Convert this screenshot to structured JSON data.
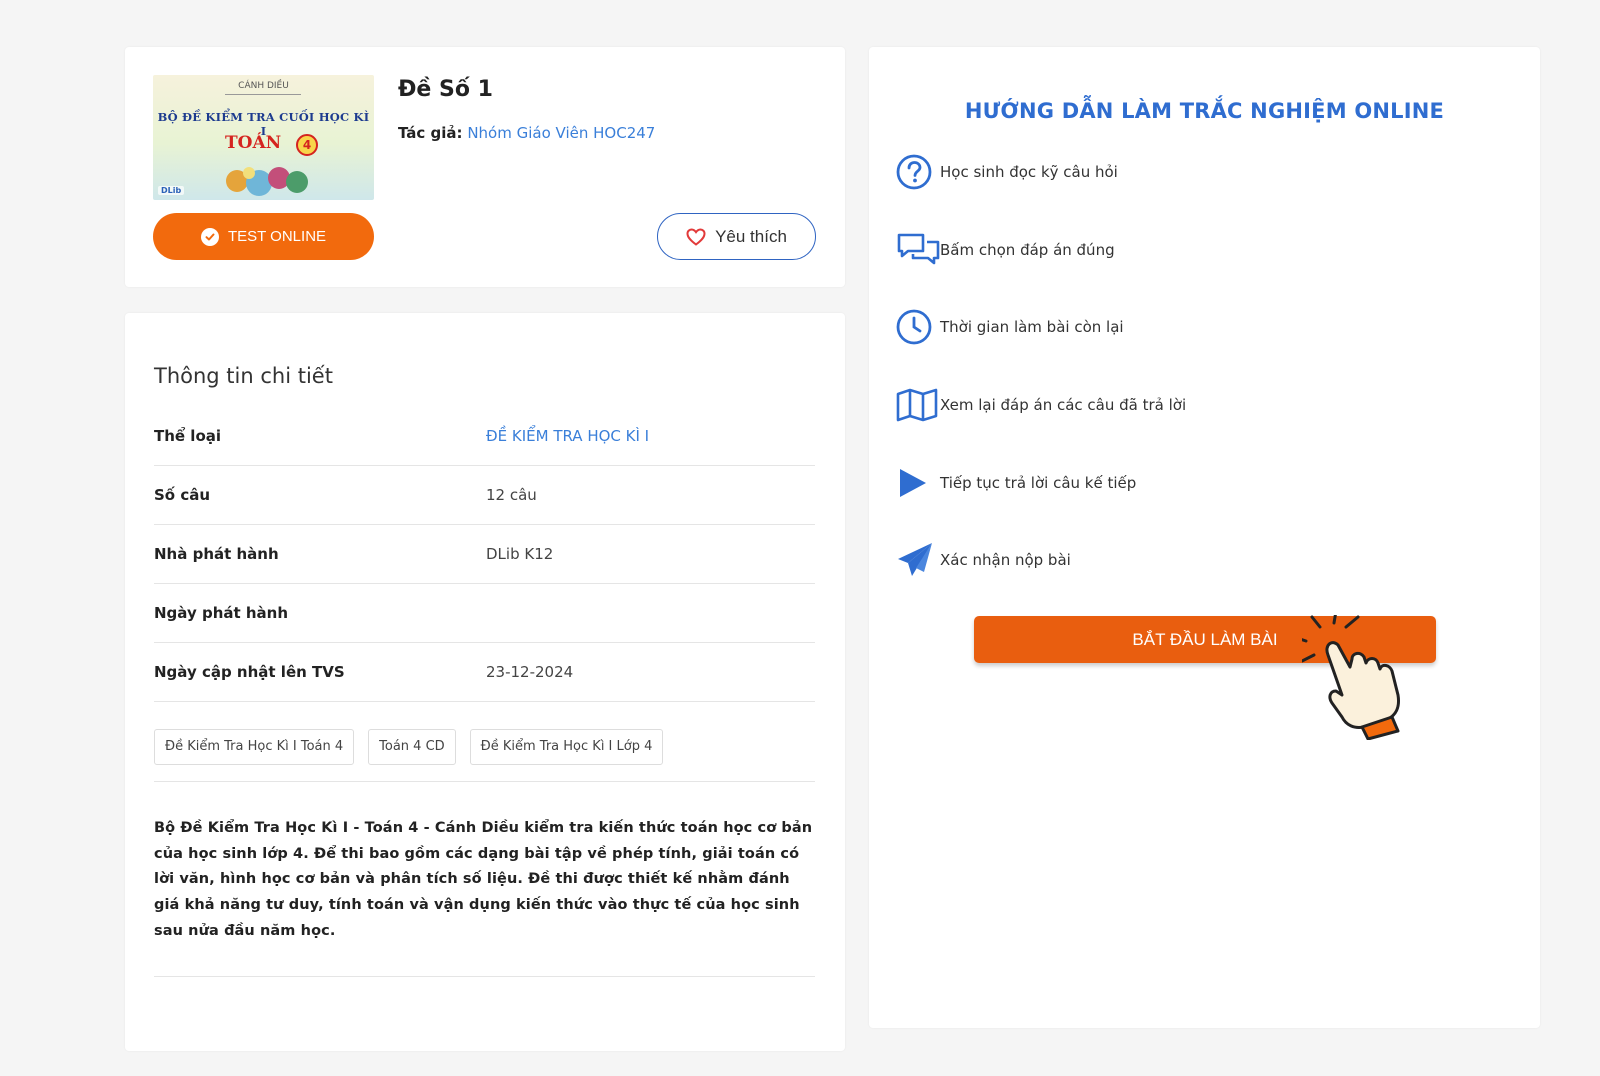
{
  "doc": {
    "cover": {
      "publisher": "CÁNH DIỀU",
      "series": "BỘ ĐỀ KIỂM TRA CUỐI HỌC KÌ I",
      "subject": "TOÁN",
      "grade": "4",
      "brand": "DLib"
    },
    "title": "Đề Số 1",
    "author_label": "Tác giả:",
    "author": "Nhóm Giáo Viên HOC247",
    "test_button": "TEST ONLINE",
    "favorite_button": "Yêu thích"
  },
  "details": {
    "title": "Thông tin chi tiết",
    "rows": [
      {
        "label": "Thể loại",
        "value": "ĐỀ KIỂM TRA HỌC KÌ I"
      },
      {
        "label": "Số câu",
        "value": "12 câu"
      },
      {
        "label": "Nhà phát hành",
        "value": "DLib K12"
      },
      {
        "label": "Ngày phát hành",
        "value": ""
      },
      {
        "label": "Ngày cập nhật lên TVS",
        "value": "23-12-2024"
      }
    ],
    "tags": [
      "Đề Kiểm Tra Học Kì I Toán 4",
      "Toán 4 CD",
      "Đề Kiểm Tra Học Kì I Lớp 4"
    ],
    "description_lead": "Bộ Đề Kiểm Tra Học Kì I - Toán 4 - Cánh Diều",
    "description_rest": " kiểm tra kiến thức toán học cơ bản của học sinh lớp 4. Để thi bao gồm các dạng bài tập về phép tính, giải toán có lời văn, hình học cơ bản và phân tích số liệu. Đề thi được thiết kế nhằm đánh giá khả năng tư duy, tính toán và vận dụng kiến thức vào thực tế của học sinh sau nửa đầu năm học."
  },
  "guide": {
    "title": "HƯỚNG DẪN LÀM TRẮC NGHIỆM ONLINE",
    "items": [
      {
        "icon": "question-icon",
        "text": "Học sinh đọc kỹ câu hỏi"
      },
      {
        "icon": "chat-icon",
        "text": "Bấm chọn đáp án đúng"
      },
      {
        "icon": "clock-icon",
        "text": "Thời gian làm bài còn lại"
      },
      {
        "icon": "map-icon",
        "text": "Xem lại đáp án các câu đã trả lời"
      },
      {
        "icon": "play-icon",
        "text": "Tiếp tục trả lời câu kế tiếp"
      },
      {
        "icon": "send-icon",
        "text": "Xác nhận nộp bài"
      }
    ],
    "start_button": "BẮT ĐẦU LÀM BÀI"
  },
  "colors": {
    "accent_orange": "#f26a0d",
    "start_orange": "#e95e0f",
    "link_blue": "#3a7fd9",
    "icon_blue": "#2f6dd0"
  }
}
